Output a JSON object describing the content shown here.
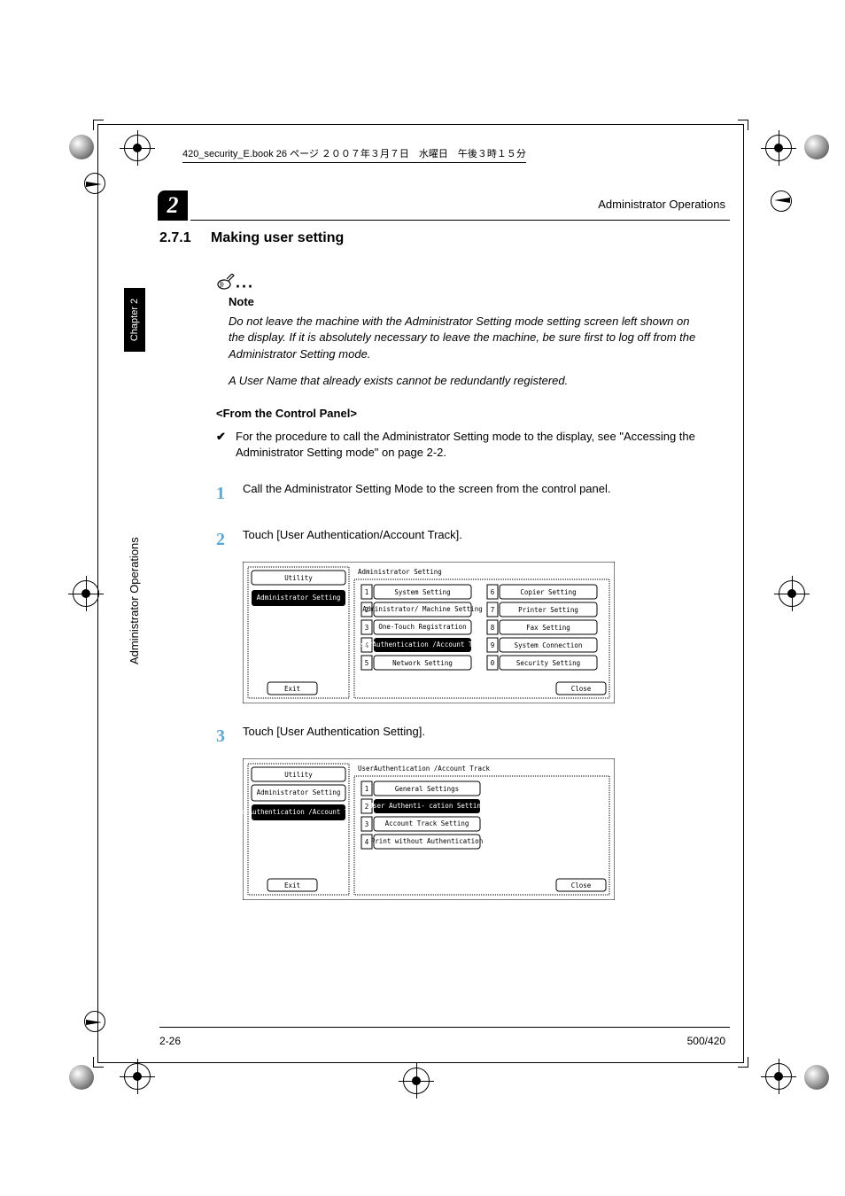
{
  "bookline": "420_security_E.book  26 ページ  ２００７年３月７日　水曜日　午後３時１５分",
  "chapter_badge": "2",
  "running_header": "Administrator Operations",
  "side_tab": "Chapter 2",
  "side_label": "Administrator Operations",
  "section": {
    "number": "2.7.1",
    "title": "Making user setting"
  },
  "note": {
    "label": "Note",
    "body1": "Do not leave the machine with the Administrator Setting mode setting screen left shown on the display. If it is absolutely necessary to leave the machine, be sure first to log off from the Administrator Setting mode.",
    "body2": "A User Name that already exists cannot be redundantly registered."
  },
  "subhead": "<From the Control Panel>",
  "check": "For the procedure to call the Administrator Setting mode to the display, see \"Accessing the Administrator Setting mode\" on page 2-2.",
  "steps": {
    "s1": "Call the Administrator Setting Mode to the screen from the control panel.",
    "s2": "Touch [User Authentication/Account Track].",
    "s3": "Touch [User Authentication Setting]."
  },
  "screen1": {
    "header": "Administrator Setting",
    "left_tab1": "Utility",
    "left_tab2": "Administrator Setting",
    "exit": "Exit",
    "close": "Close",
    "items": [
      {
        "n": "1",
        "label": "System Setting"
      },
      {
        "n": "2",
        "label": "Administrator/ Machine Setting"
      },
      {
        "n": "3",
        "label": "One-Touch Registration"
      },
      {
        "n": "4",
        "label": "UserAuthentication /Account Track"
      },
      {
        "n": "5",
        "label": "Network Setting"
      },
      {
        "n": "6",
        "label": "Copier Setting"
      },
      {
        "n": "7",
        "label": "Printer Setting"
      },
      {
        "n": "8",
        "label": "Fax Setting"
      },
      {
        "n": "9",
        "label": "System Connection"
      },
      {
        "n": "0",
        "label": "Security Setting"
      }
    ]
  },
  "screen2": {
    "header": "UserAuthentication /Account Track",
    "left_tab1": "Utility",
    "left_tab2": "Administrator Setting",
    "left_tab3": "UserAuthentication /Account Track",
    "exit": "Exit",
    "close": "Close",
    "items": [
      {
        "n": "1",
        "label": "General Settings"
      },
      {
        "n": "2",
        "label": "User Authenti- cation Setting"
      },
      {
        "n": "3",
        "label": "Account Track Setting"
      },
      {
        "n": "4",
        "label": "Print without Authentication"
      }
    ]
  },
  "footer": {
    "left": "2-26",
    "right": "500/420"
  }
}
